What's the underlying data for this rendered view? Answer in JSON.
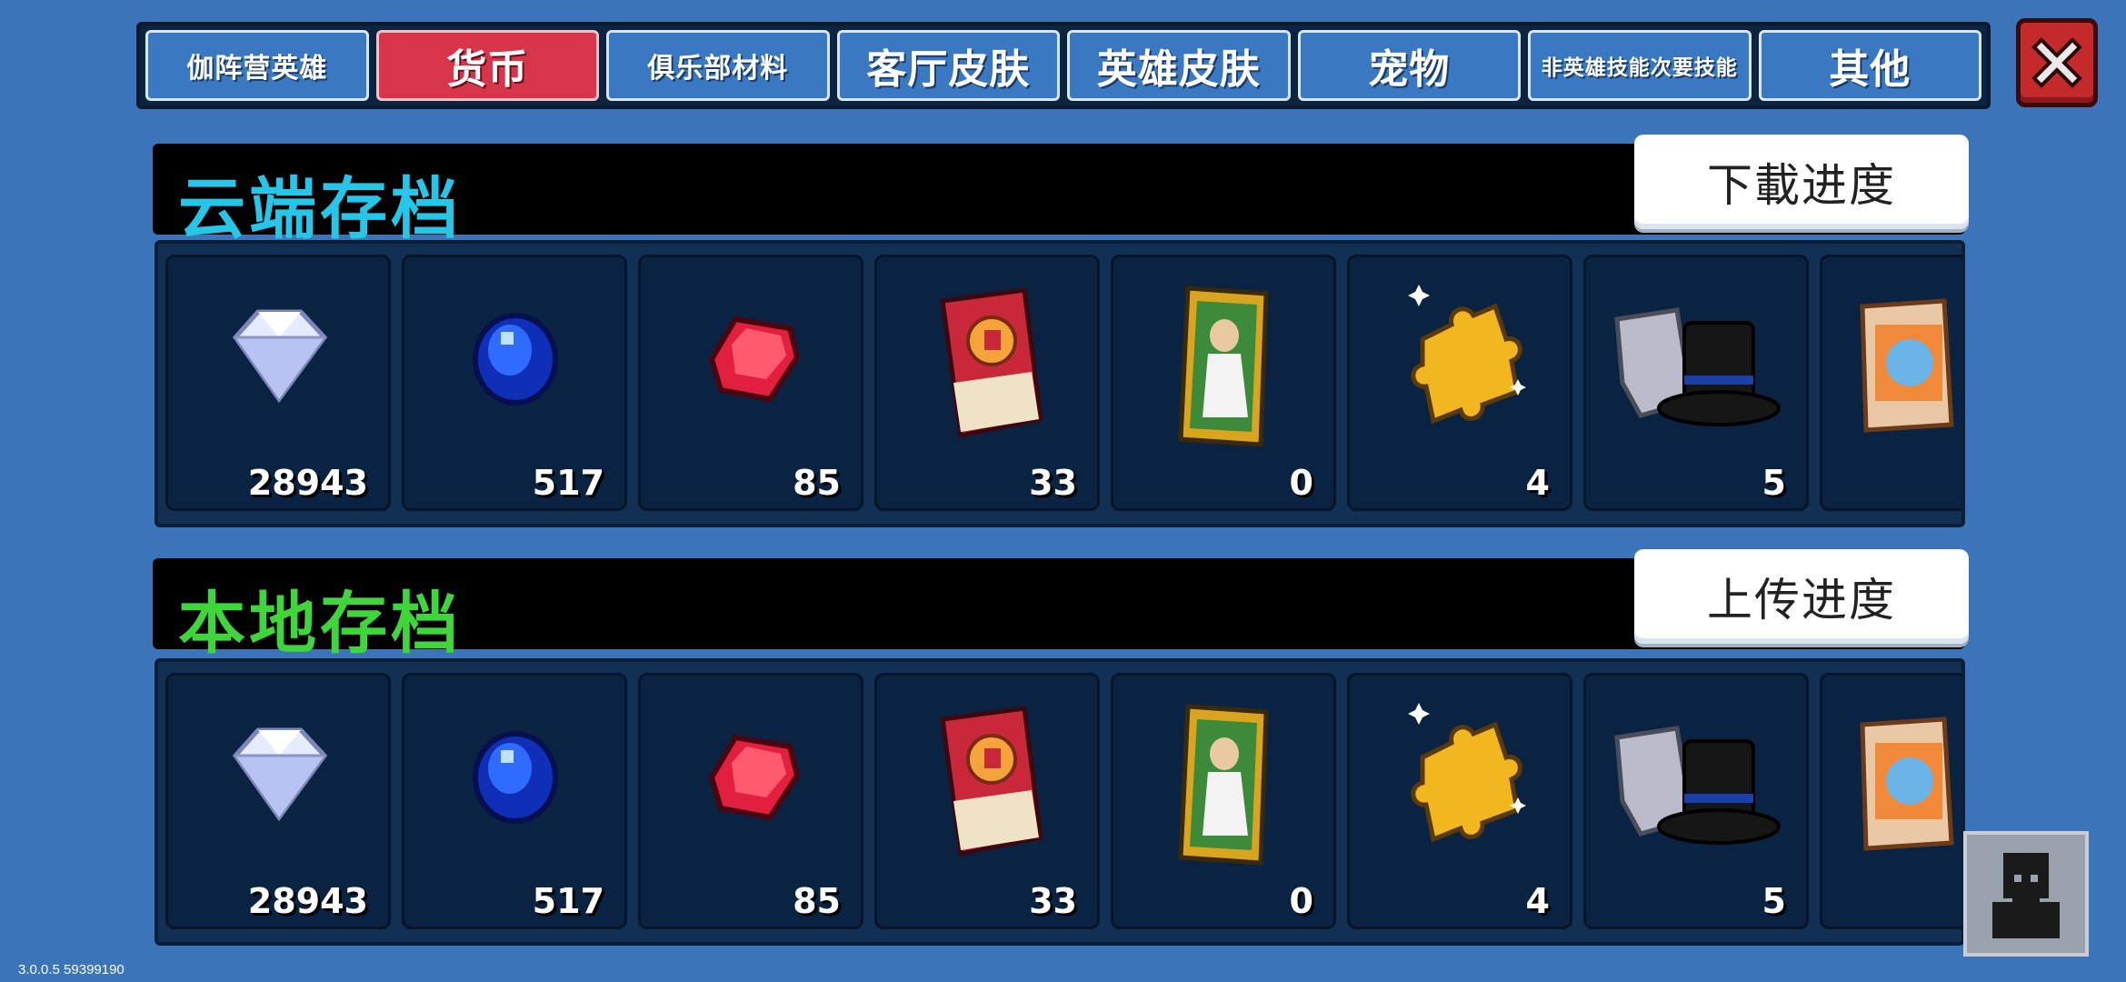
{
  "tabs": [
    {
      "label": "伽阵营英雄"
    },
    {
      "label": "货币",
      "active": true
    },
    {
      "label": "俱乐部材料"
    },
    {
      "label": "客厅皮肤"
    },
    {
      "label": "英雄皮肤"
    },
    {
      "label": "宠物"
    },
    {
      "label": "非英雄技能次要技能"
    },
    {
      "label": "其他"
    }
  ],
  "close_icon": "close-x-icon",
  "cloud": {
    "title": "云端存档",
    "button": "下載进度",
    "items": [
      {
        "icon": "white-diamond-icon",
        "count": "28943"
      },
      {
        "icon": "blue-gem-icon",
        "count": "517"
      },
      {
        "icon": "red-gem-icon",
        "count": "85"
      },
      {
        "icon": "ticket-icon",
        "count": "33"
      },
      {
        "icon": "card-icon",
        "count": "0"
      },
      {
        "icon": "puzzle-piece-icon",
        "count": "4"
      },
      {
        "icon": "top-hat-icon",
        "count": "5"
      },
      {
        "icon": "bag-icon",
        "count": ""
      }
    ]
  },
  "local": {
    "title": "本地存档",
    "button": "上传进度",
    "items": [
      {
        "icon": "white-diamond-icon",
        "count": "28943"
      },
      {
        "icon": "blue-gem-icon",
        "count": "517"
      },
      {
        "icon": "red-gem-icon",
        "count": "85"
      },
      {
        "icon": "ticket-icon",
        "count": "33"
      },
      {
        "icon": "card-icon",
        "count": "0"
      },
      {
        "icon": "puzzle-piece-icon",
        "count": "4"
      },
      {
        "icon": "top-hat-icon",
        "count": "5"
      },
      {
        "icon": "bag-icon",
        "count": ""
      }
    ]
  },
  "version": "3.0.0.5 59399190",
  "colors": {
    "background": "#3b74b8",
    "active_tab": "#d8344a",
    "cloud_title": "#25c6e8",
    "local_title": "#3ed63a"
  }
}
